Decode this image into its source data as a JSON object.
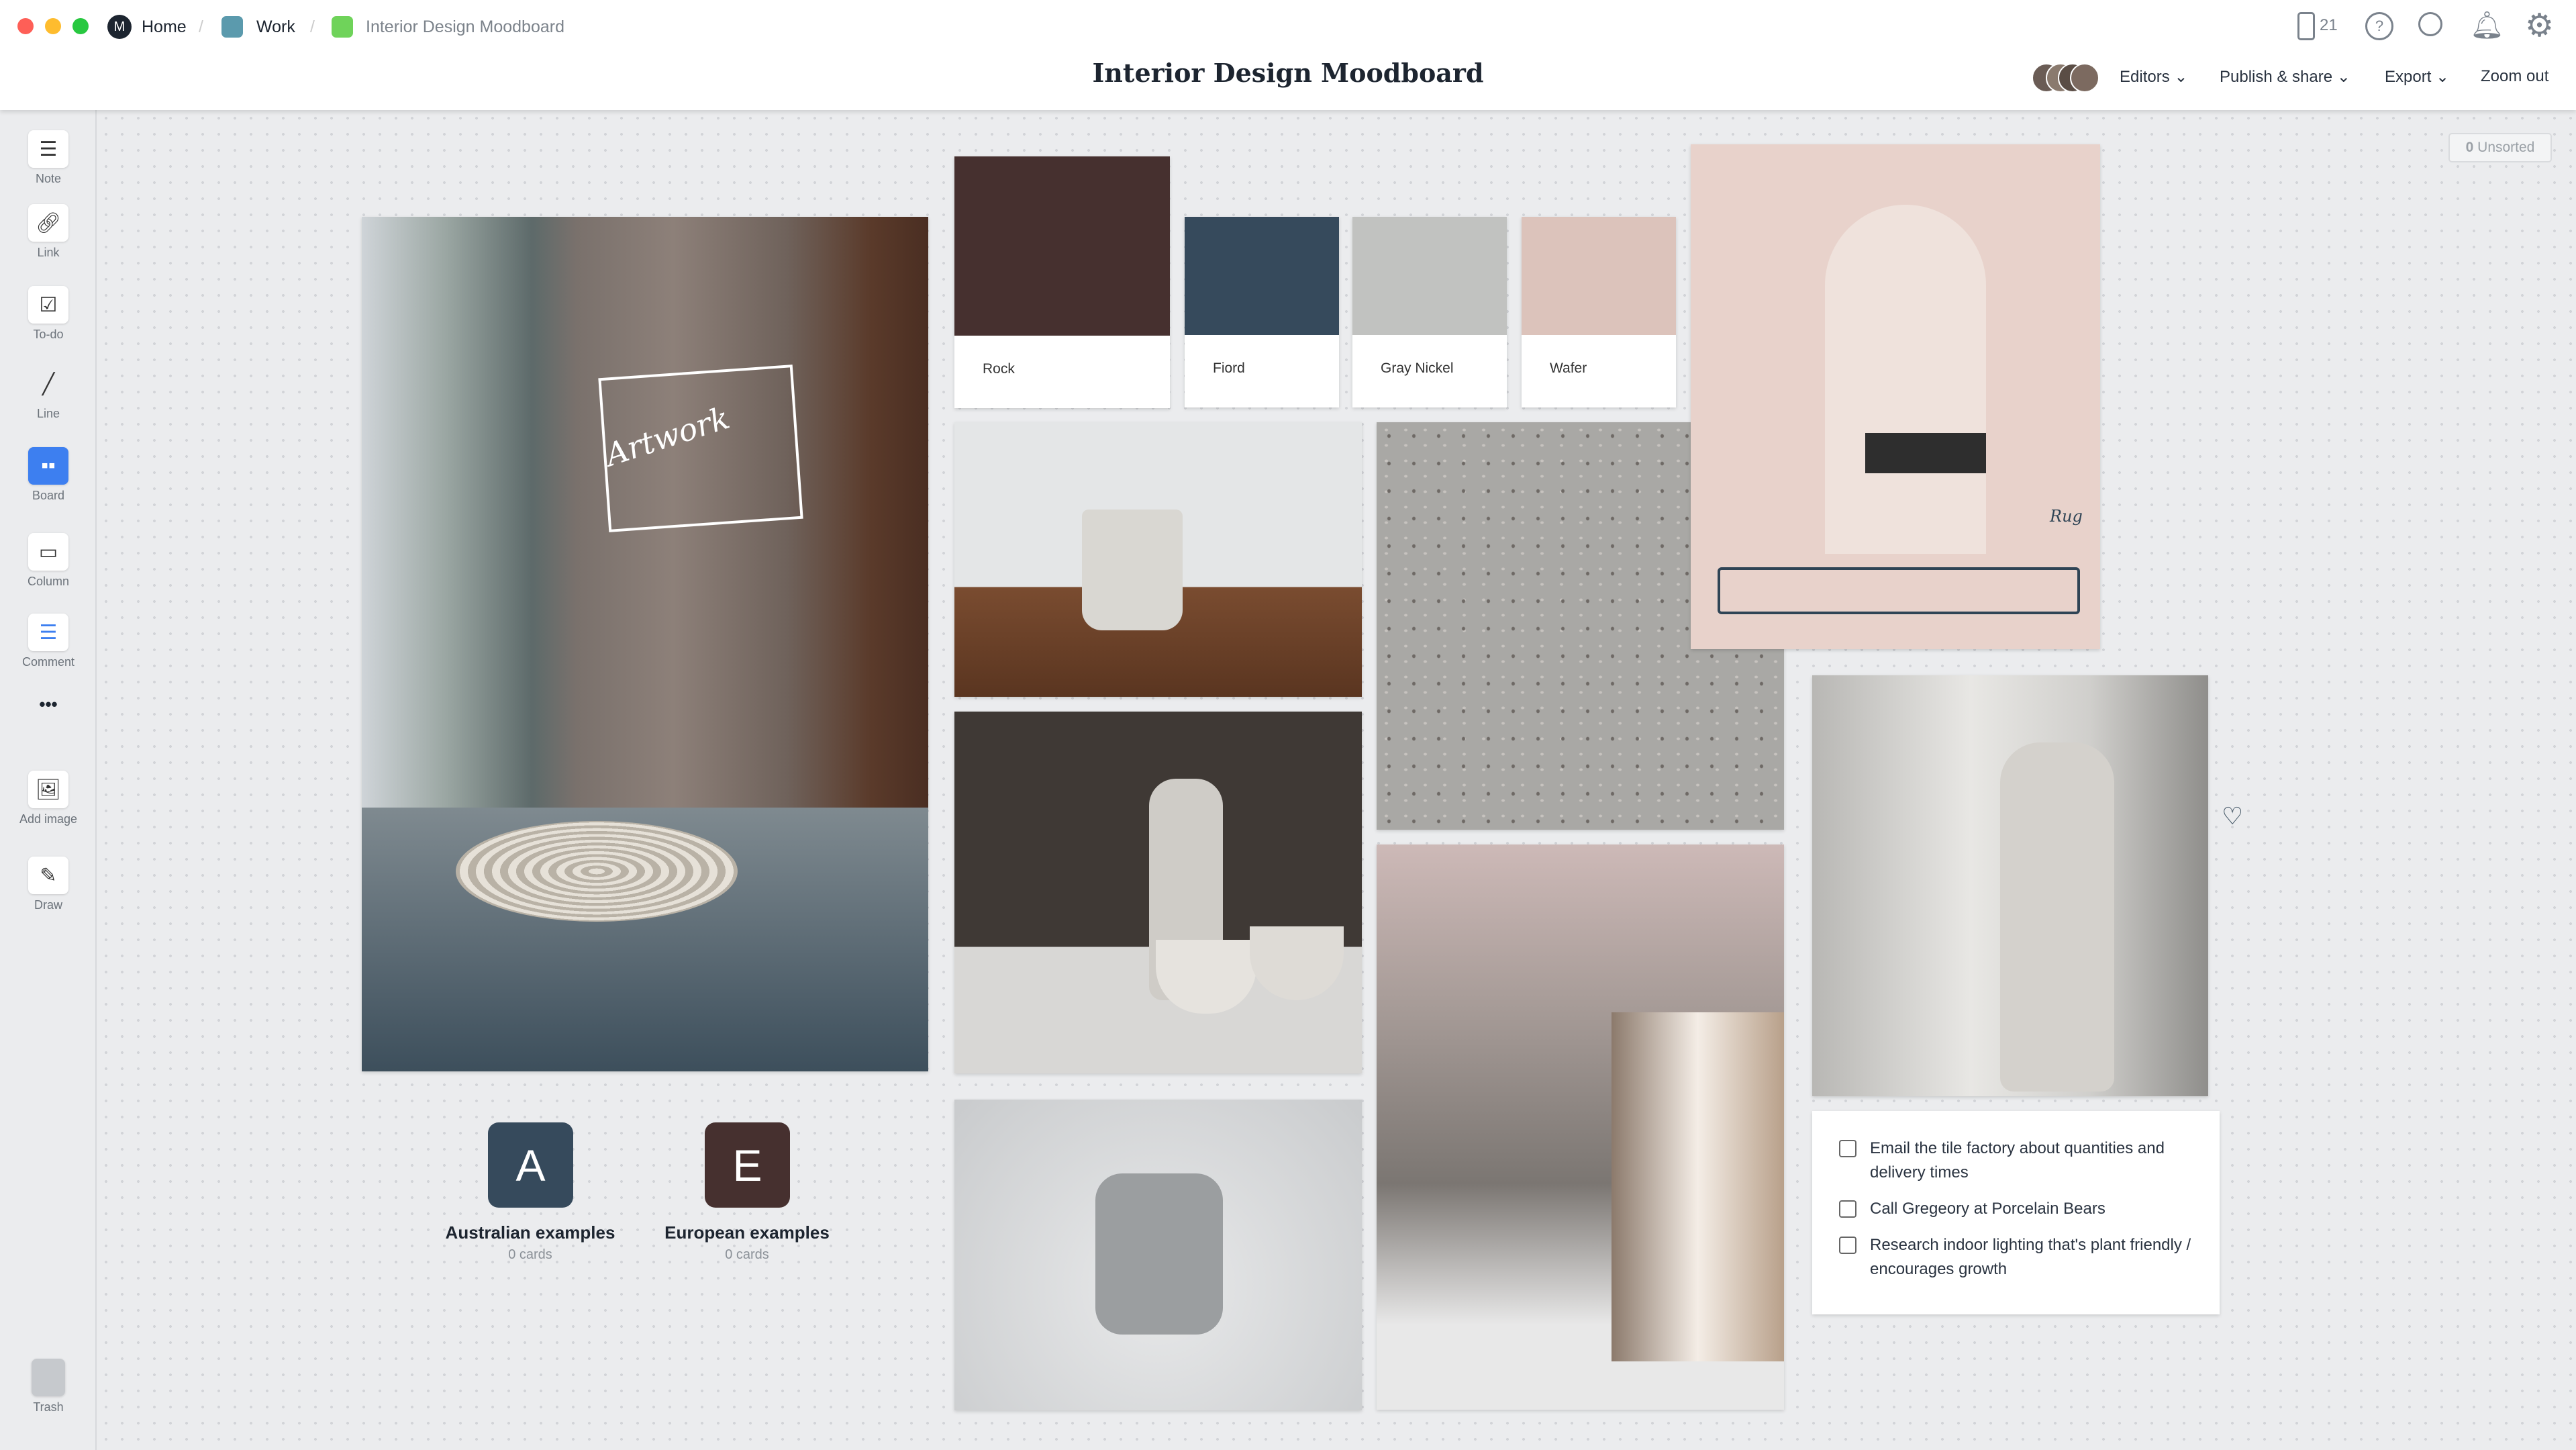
{
  "breadcrumb": {
    "home": "Home",
    "work": "Work",
    "current": "Interior Design Moodboard",
    "work_color": "#5b9aad",
    "current_color": "#6fd35a"
  },
  "header": {
    "title": "Interior Design Moodboard",
    "device_count": "21",
    "editors": "Editors",
    "publish": "Publish & share",
    "export": "Export",
    "zoom_out": "Zoom out"
  },
  "sidebar": {
    "note": "Note",
    "link": "Link",
    "todo": "To-do",
    "line": "Line",
    "board": "Board",
    "column": "Column",
    "comment": "Comment",
    "more": "•••",
    "add_image": "Add image",
    "draw": "Draw",
    "trash": "Trash"
  },
  "unsorted": {
    "count": "0",
    "label": "Unsorted"
  },
  "swatches": [
    {
      "name": "Rock",
      "color": "#46302f"
    },
    {
      "name": "Fiord",
      "color": "#364a5c"
    },
    {
      "name": "Gray Nickel",
      "color": "#c1c2c0"
    },
    {
      "name": "Wafer",
      "color": "#dcc3bb"
    }
  ],
  "annotations": {
    "artwork": "Artwork",
    "rug": "Rug"
  },
  "boards": [
    {
      "letter": "A",
      "title": "Australian examples",
      "count": "0 cards",
      "color": "#364a5c"
    },
    {
      "letter": "E",
      "title": "European examples",
      "count": "0 cards",
      "color": "#46302f"
    }
  ],
  "todos": [
    "Email the tile factory about quantities and delivery times",
    "Call Gregeory at Porcelain Bears",
    "Research indoor lighting that's plant friendly / encourages growth"
  ]
}
